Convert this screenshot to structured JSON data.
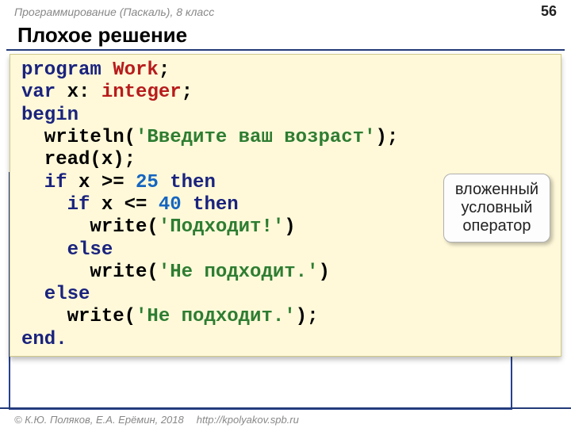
{
  "header": {
    "course": "Программирование (Паскаль), 8 класс",
    "page_number": "56"
  },
  "title": "Плохое решение",
  "code": {
    "l1": {
      "a": "program ",
      "b": "Work",
      "c": ";"
    },
    "l2": {
      "a": "var",
      "b": " x: ",
      "c": "integer",
      "d": ";"
    },
    "l3": {
      "a": "begin"
    },
    "l4": {
      "a": "  writeln(",
      "b": "'Введите ваш возраст'",
      "c": ");"
    },
    "l5": {
      "a": "  read(x);"
    },
    "l6": {
      "a": "  if",
      "b": " x >= ",
      "c": "25",
      "d": " then"
    },
    "l7": {
      "a": "    if",
      "b": " x <= ",
      "c": "40",
      "d": " then"
    },
    "l8": {
      "a": "      write(",
      "b": "'Подходит!'",
      "c": ")"
    },
    "l9": {
      "a": "    else"
    },
    "l10": {
      "a": "      write(",
      "b": "'Не подходит.'",
      "c": ")"
    },
    "l11": {
      "a": "  else"
    },
    "l12": {
      "a": "    write(",
      "b": "'Не подходит.'",
      "c": ");"
    },
    "l13": {
      "a": "end."
    }
  },
  "callout": {
    "line1": "вложенный",
    "line2": "условный",
    "line3": "оператор"
  },
  "footer": {
    "copyright": "© К.Ю. Поляков, Е.А. Ерёмин, 2018",
    "url": "http://kpolyakov.spb.ru"
  }
}
